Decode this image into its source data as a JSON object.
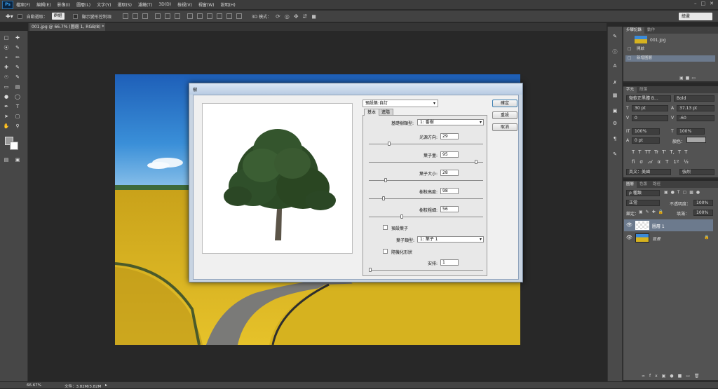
{
  "app": {
    "logo": "Ps"
  },
  "menu": [
    "檔案(F)",
    "編輯(E)",
    "影像(I)",
    "圖層(L)",
    "文字(Y)",
    "選取(S)",
    "濾鏡(T)",
    "3D(D)",
    "檢視(V)",
    "視窗(W)",
    "說明(H)"
  ],
  "options": {
    "auto_select": "自動選取：",
    "auto_select_value": "群組",
    "show_transform": "顯示變形控制項",
    "mode3d": "3D 模式："
  },
  "workspace": "繪畫",
  "document_tab": "001.jpg @ 66.7% (圖層 1, RGB/8) *",
  "status": {
    "zoom": "66.67%",
    "doc": "文件：3.82M/3.82M"
  },
  "history_panel": {
    "tabs": [
      "步驟記錄",
      "動作"
    ],
    "snapshot": "001.jpg",
    "items": [
      "開啟",
      "新增圖層"
    ]
  },
  "char_panel": {
    "tabs": [
      "字元",
      "段落"
    ],
    "font": "微軟正黑體 B...",
    "style": "Bold",
    "size": "30 pt",
    "leading": "37.13 pt",
    "kerning": "0",
    "tracking": "-60",
    "vscale": "100%",
    "hscale": "100%",
    "baseline": "0 pt",
    "color_label": "顏色：",
    "lang": "英文：美國",
    "aa": "強烈",
    "typo": [
      "T",
      "T",
      "TT",
      "Tr",
      "T'",
      "T,",
      "T",
      "T"
    ]
  },
  "layers_panel": {
    "tabs": [
      "圖層",
      "色版",
      "路徑"
    ],
    "filter": "ρ 種類",
    "blend": "正常",
    "opacity_label": "不透明度：",
    "opacity": "100%",
    "lock_label": "鎖定：",
    "fill_label": "填滿：",
    "fill": "100%",
    "layers": [
      {
        "name": "圖層 1"
      },
      {
        "name": "背景"
      }
    ]
  },
  "dialog": {
    "title": "樹",
    "preset_label": "預設集:自訂",
    "tabs": [
      "基本",
      "進階"
    ],
    "buttons": {
      "ok": "確定",
      "reset": "重設",
      "cancel": "取消"
    },
    "base_type_label": "基礎樹類型:",
    "base_type_value": "1: 番樹",
    "params": [
      {
        "label": "光源方向:",
        "value": "29",
        "pos": 0.17
      },
      {
        "label": "葉子量:",
        "value": "95",
        "pos": 0.95
      },
      {
        "label": "葉子大小:",
        "value": "28",
        "pos": 0.14
      },
      {
        "label": "樹枝高度:",
        "value": "98",
        "pos": 0.12
      },
      {
        "label": "樹枝粗細:",
        "value": "56",
        "pos": 0.28
      }
    ],
    "default_leaf_label": "預設葉子",
    "leaf_type_label": "葉子類型:",
    "leaf_type_value": "1: 葉子 1",
    "random_label": "隨機化形狀",
    "seed_label": "安排:",
    "seed_value": "1",
    "seed_pos": 0.0
  }
}
